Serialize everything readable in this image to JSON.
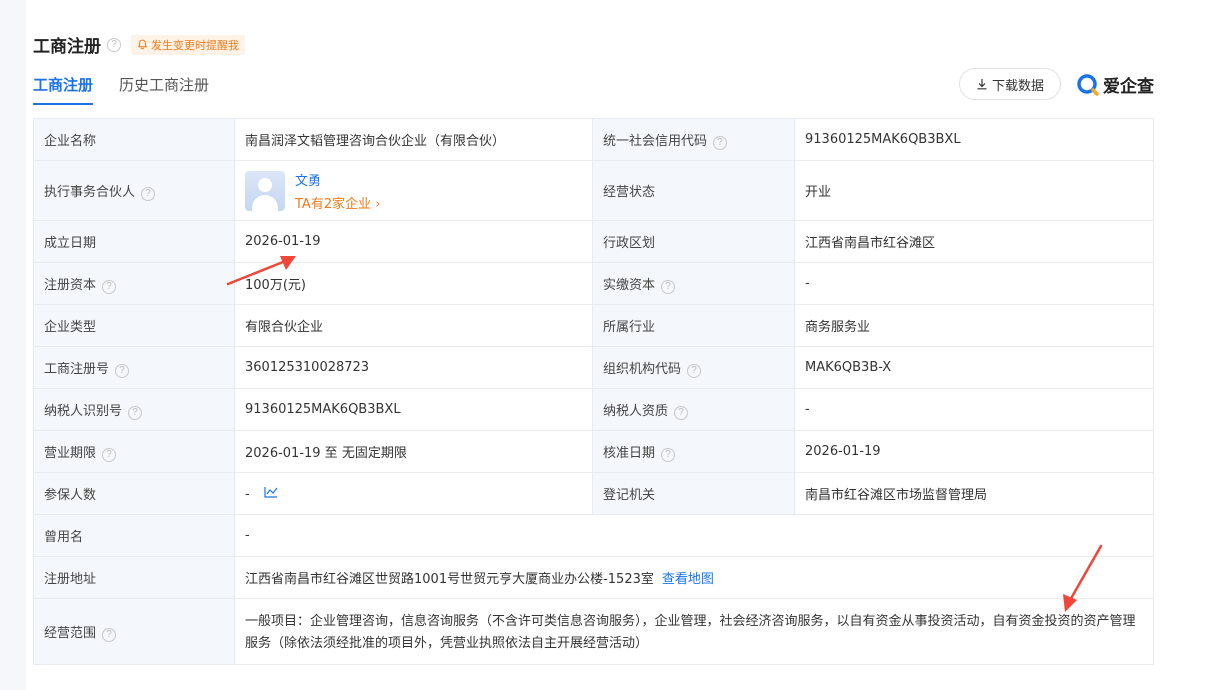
{
  "header": {
    "title": "工商注册",
    "remind_label": "发生变更时提醒我"
  },
  "tabs": [
    {
      "label": "工商注册",
      "active": true
    },
    {
      "label": "历史工商注册",
      "active": false
    }
  ],
  "toolbar": {
    "download_label": "下载数据",
    "brand": "爱企查"
  },
  "rows": {
    "company_name": {
      "label": "企业名称",
      "value": "南昌润泽文韬管理咨询合伙企业（有限合伙）"
    },
    "credit_code": {
      "label": "统一社会信用代码",
      "value": "91360125MAK6QB3BXL"
    },
    "partner": {
      "label": "执行事务合伙人",
      "name": "文勇",
      "sub": "TA有2家企业 ›"
    },
    "status": {
      "label": "经营状态",
      "value": "开业"
    },
    "founded": {
      "label": "成立日期",
      "value": "2026-01-19"
    },
    "region": {
      "label": "行政区划",
      "value": "江西省南昌市红谷滩区"
    },
    "reg_capital": {
      "label": "注册资本",
      "value": "100万(元)"
    },
    "paid_capital": {
      "label": "实缴资本",
      "value": "-"
    },
    "company_type": {
      "label": "企业类型",
      "value": "有限合伙企业"
    },
    "industry": {
      "label": "所属行业",
      "value": "商务服务业"
    },
    "reg_number": {
      "label": "工商注册号",
      "value": "360125310028723"
    },
    "org_code": {
      "label": "组织机构代码",
      "value": "MAK6QB3B-X"
    },
    "taxpayer_id": {
      "label": "纳税人识别号",
      "value": "91360125MAK6QB3BXL"
    },
    "taxpayer_qual": {
      "label": "纳税人资质",
      "value": "-"
    },
    "term": {
      "label": "营业期限",
      "value": "2026-01-19 至 无固定期限"
    },
    "approval_date": {
      "label": "核准日期",
      "value": "2026-01-19"
    },
    "insured": {
      "label": "参保人数",
      "value": "-"
    },
    "authority": {
      "label": "登记机关",
      "value": "南昌市红谷滩区市场监督管理局"
    },
    "former_name": {
      "label": "曾用名",
      "value": "-"
    },
    "address": {
      "label": "注册地址",
      "value": "江西省南昌市红谷滩区世贸路1001号世贸元亨大厦商业办公楼-1523室",
      "link": "查看地图"
    },
    "scope": {
      "label": "经营范围",
      "value": "一般项目：企业管理咨询，信息咨询服务（不含许可类信息咨询服务），企业管理，社会经济咨询服务，以自有资金从事投资活动，自有资金投资的资产管理服务（除依法须经批准的项目外，凭营业执照依法自主开展经营活动）"
    }
  },
  "colors": {
    "accent": "#1a73e8",
    "orange": "#f27a1a",
    "arrow": "#f0473a"
  }
}
